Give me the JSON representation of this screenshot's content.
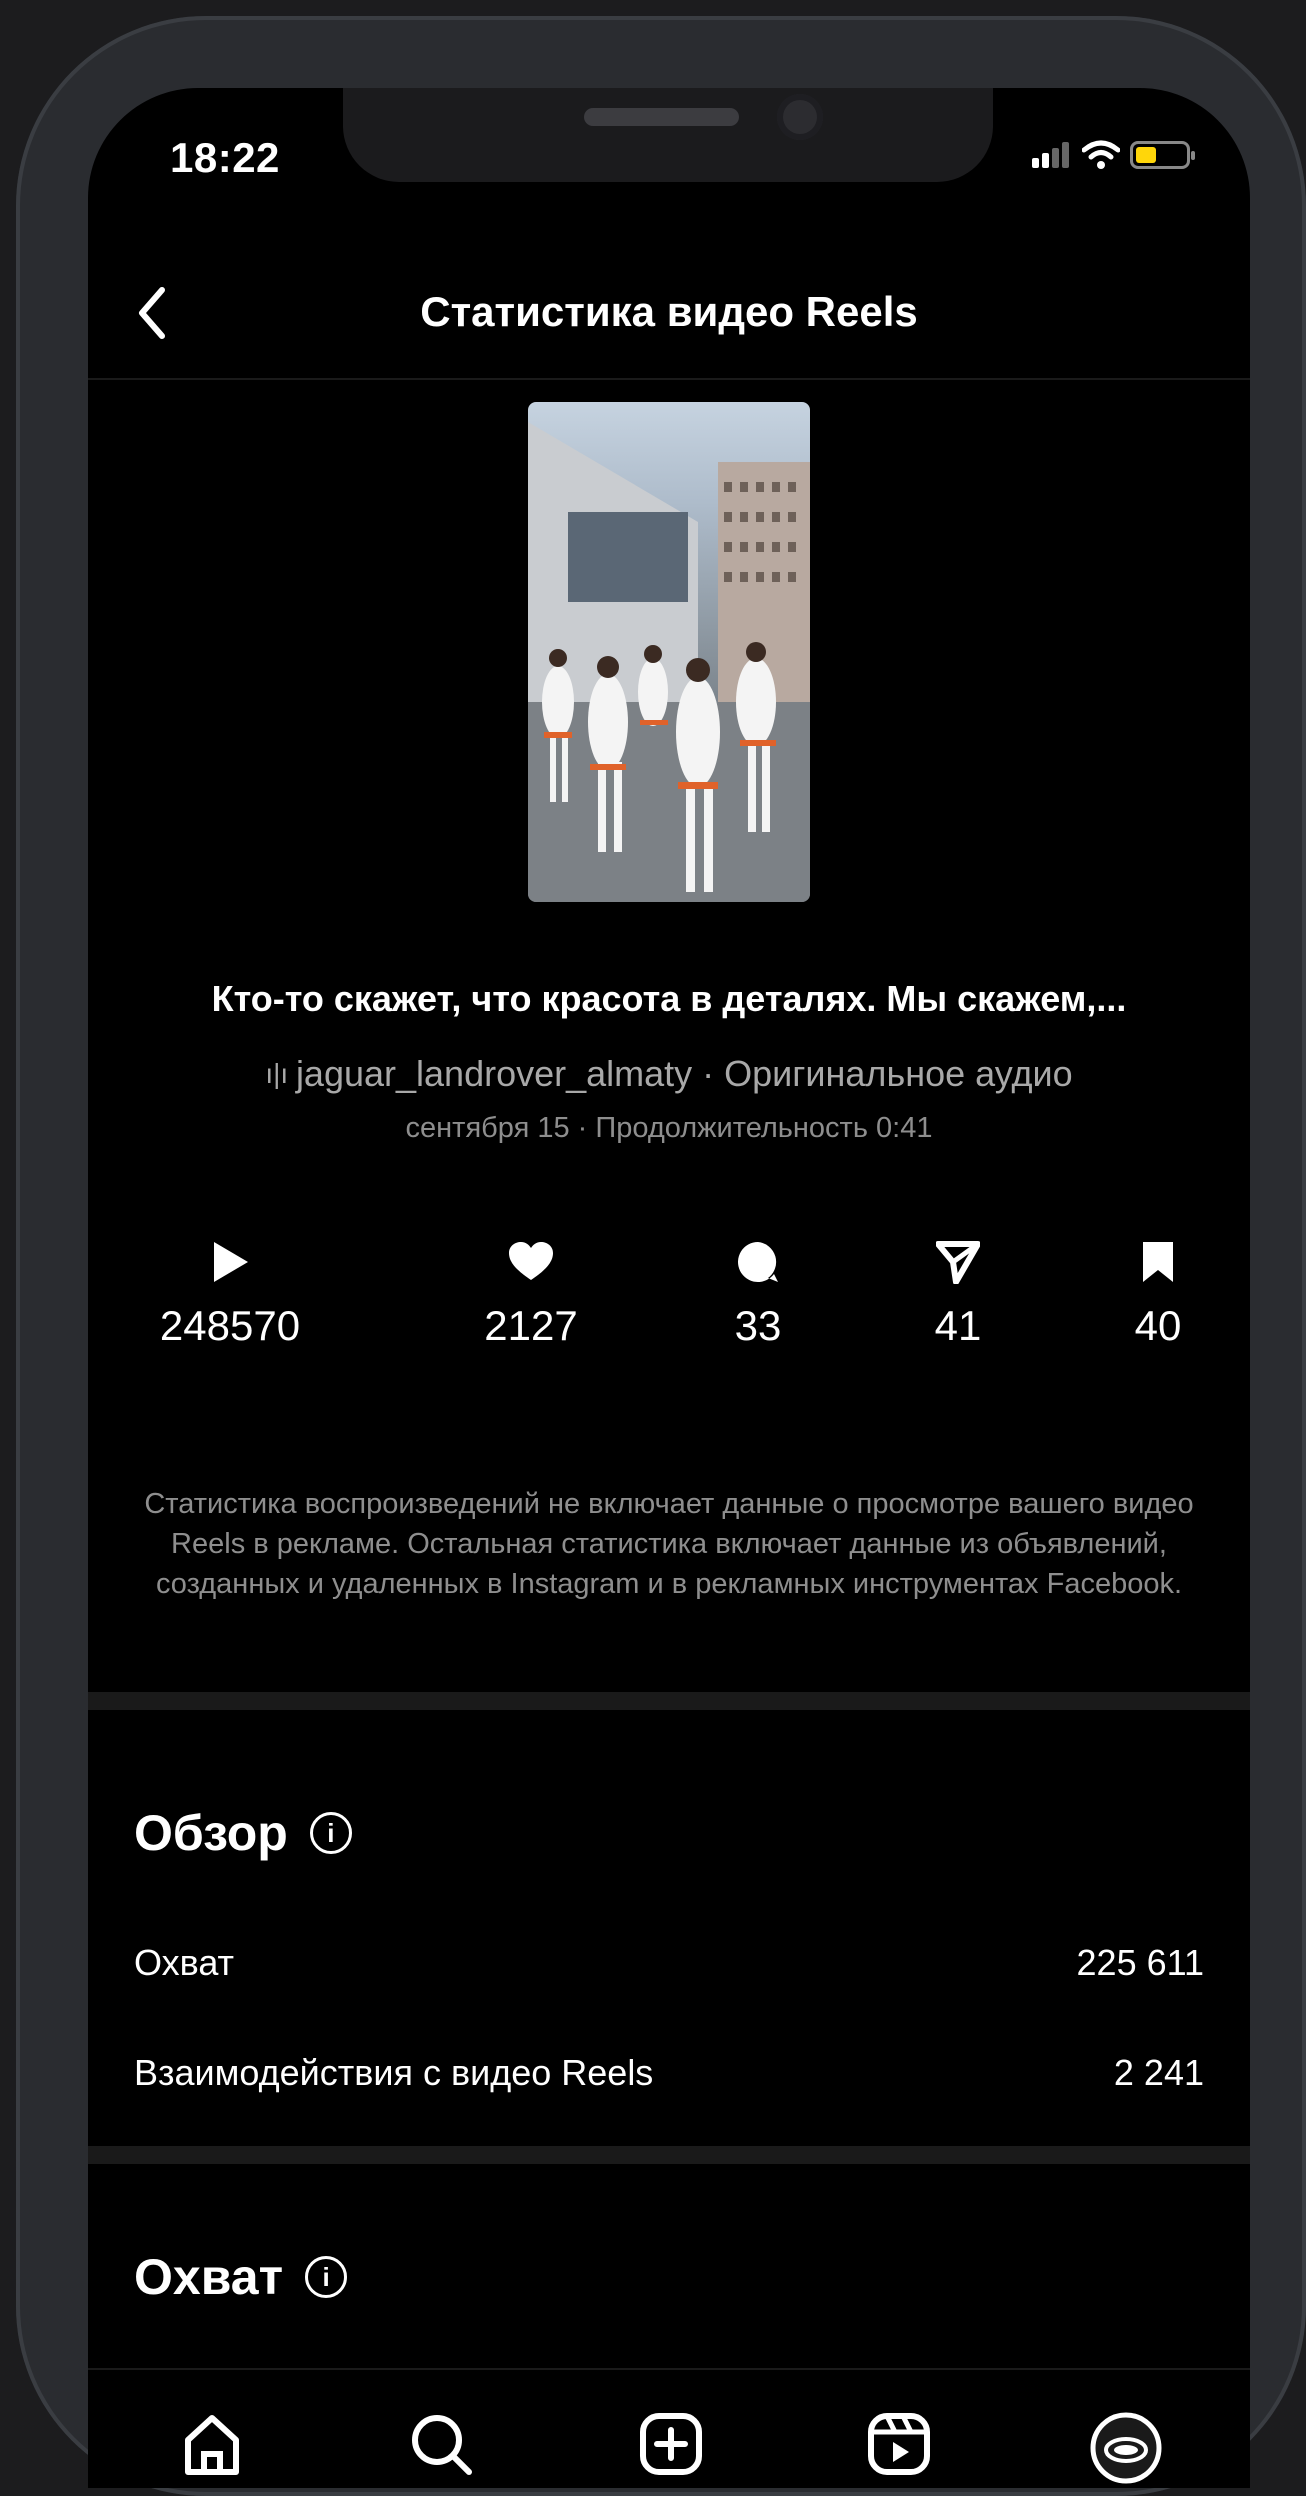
{
  "status_bar": {
    "time": "18:22"
  },
  "nav": {
    "title": "Статистика видео Reels"
  },
  "reel": {
    "caption": "Кто-то скажет, что красота в деталях. Мы скажем,...",
    "audio": "jaguar_landrover_almaty · Оригинальное аудио",
    "meta": "сентября 15 · Продолжительность 0:41"
  },
  "metrics": [
    {
      "icon": "play-icon",
      "value": "248570"
    },
    {
      "icon": "heart-icon",
      "value": "2127"
    },
    {
      "icon": "comment-icon",
      "value": "33"
    },
    {
      "icon": "share-icon",
      "value": "41"
    },
    {
      "icon": "bookmark-icon",
      "value": "40"
    }
  ],
  "disclaimer": "Статистика воспроизведений не включает данные о просмотре вашего видео Reels в рекламе. Остальная статистика включает данные из объявлений, созданных и удаленных в Instagram и в рекламных инструментах Facebook.",
  "overview": {
    "title": "Обзор",
    "rows": [
      {
        "label": "Охват",
        "value": "225 611"
      },
      {
        "label": "Взаимодействия с видео Reels",
        "value": "2 241"
      }
    ]
  },
  "reach": {
    "title": "Охват"
  },
  "tabbar": [
    "home-icon",
    "search-icon",
    "create-icon",
    "reels-icon",
    "profile-avatar"
  ],
  "colors": {
    "background": "#000000",
    "secondary_text": "#a8a8a8",
    "battery": "#ffd60a"
  }
}
